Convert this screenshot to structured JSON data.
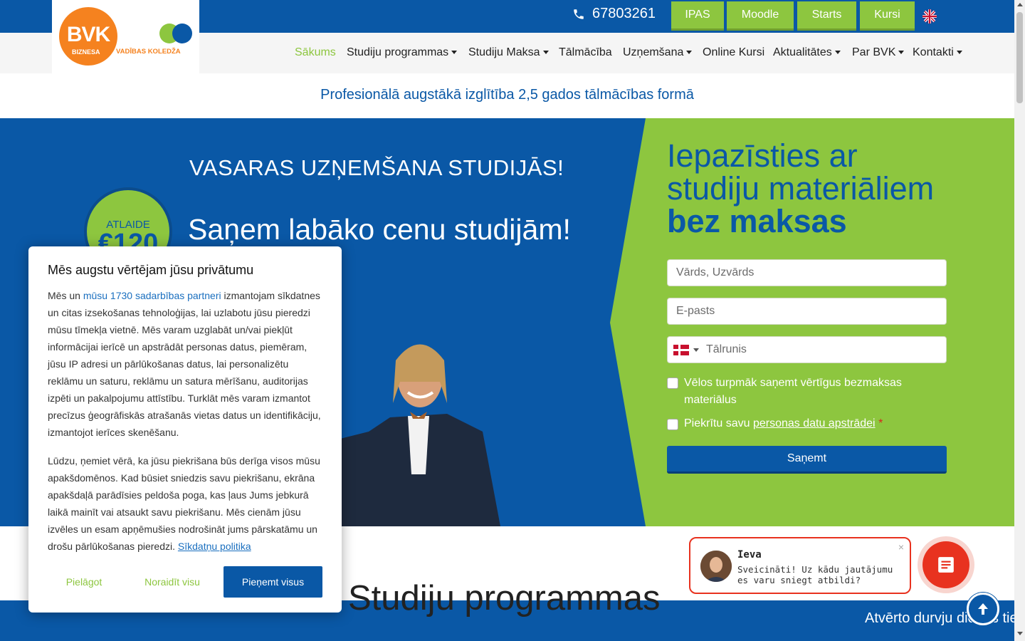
{
  "brand": {
    "logo_short": "BVK",
    "logo_sub": "BIZNESA",
    "logo_college": "VADĪBAS KOLEDŽA"
  },
  "topbar": {
    "phone": "67803261",
    "buttons": [
      "IPAS",
      "Moodle",
      "Starts",
      "Kursi"
    ],
    "language_icon": "uk-flag-icon"
  },
  "nav": {
    "items": [
      {
        "label": "Sākums",
        "dropdown": false,
        "active": true
      },
      {
        "label": "Studiju programmas",
        "dropdown": true
      },
      {
        "label": "Studiju Maksa",
        "dropdown": true
      },
      {
        "label": "Tālmācība",
        "dropdown": false
      },
      {
        "label": "Uzņemšana",
        "dropdown": true
      },
      {
        "label": "Online Kursi",
        "dropdown": false
      },
      {
        "label": "Aktualitātes",
        "dropdown": true
      },
      {
        "label": "Par BVK",
        "dropdown": true
      },
      {
        "label": "Kontakti",
        "dropdown": true
      }
    ]
  },
  "tagline": "Profesionālā augstākā izglītība 2,5 gados tālmācības formā",
  "hero": {
    "title": "VASARAS UZŅEMŠANA STUDIJĀS!",
    "badge_label": "ATLAIDE",
    "badge_value": "€120",
    "subtitle": "Saņem labāko cenu studijām!"
  },
  "form": {
    "title_line1": "Iepazīsties ar",
    "title_line2": "studiju materiāliem",
    "title_bold": "bez maksas",
    "name_placeholder": "Vārds, Uzvārds",
    "email_placeholder": "E-pasts",
    "phone_placeholder": "Tālrunis",
    "checkbox1_label": "Vēlos turpmāk saņemt vērtīgus bezmaksas materiālus",
    "checkbox2_label": "Piekrītu savu",
    "checkbox2_link": "personas datu apstrādei",
    "required_mark": "*",
    "submit": "Saņemt"
  },
  "section": {
    "title": "Studiju programmas",
    "strip_text": "Atvērto durvju dienas tie"
  },
  "cookie": {
    "title": "Mēs augstu vērtējam jūsu privātumu",
    "p1_before": "Mēs un ",
    "p1_link": "mūsu 1730 sadarbības partneri",
    "p1_after": " izmantojam sīkdatnes un citas izsekošanas tehnoloģijas, lai uzlabotu jūsu pieredzi mūsu tīmekļa vietnē. Mēs varam uzglabāt un/vai piekļūt informācijai ierīcē un apstrādāt personas datus, piemēram, jūsu IP adresi un pārlūkošanas datus, lai personalizētu reklāmu un saturu, reklāmu un satura mērīšanu, auditorijas izpēti un pakalpojumu attīstību. Turklāt mēs varam izmantot precīzus ģeogrāfiskās atrašanās vietas datus un identifikāciju, izmantojot ierīces skenēšanu.",
    "p2_text": "Lūdzu, ņemiet vērā, ka jūsu piekrišana būs derīga visos mūsu apakšdomēnos. Kad būsiet sniedzis savu piekrišanu, ekrāna apakšdaļā parādīsies peldoša poga, kas ļaus Jums jebkurā laikā mainīt vai atsaukt savu piekrišanu. Mēs cienām jūsu izvēles un esam apņēmušies nodrošināt jums pārskatāmu un drošu pārlūkošanas pieredzi. ",
    "p2_link": "Sīkdatņu politika",
    "btn_customize": "Pielāgot",
    "btn_reject": "Noraidīt visu",
    "btn_accept": "Pieņemt visus"
  },
  "chat": {
    "name": "Ieva",
    "message": "Sveicināti! Uz kādu jautājumu es varu sniegt atbildi?",
    "close": "×"
  },
  "colors": {
    "brand_blue": "#0a58a6",
    "brand_green": "#8dc63f",
    "brand_orange": "#f5821f",
    "chat_red": "#e8321f"
  }
}
